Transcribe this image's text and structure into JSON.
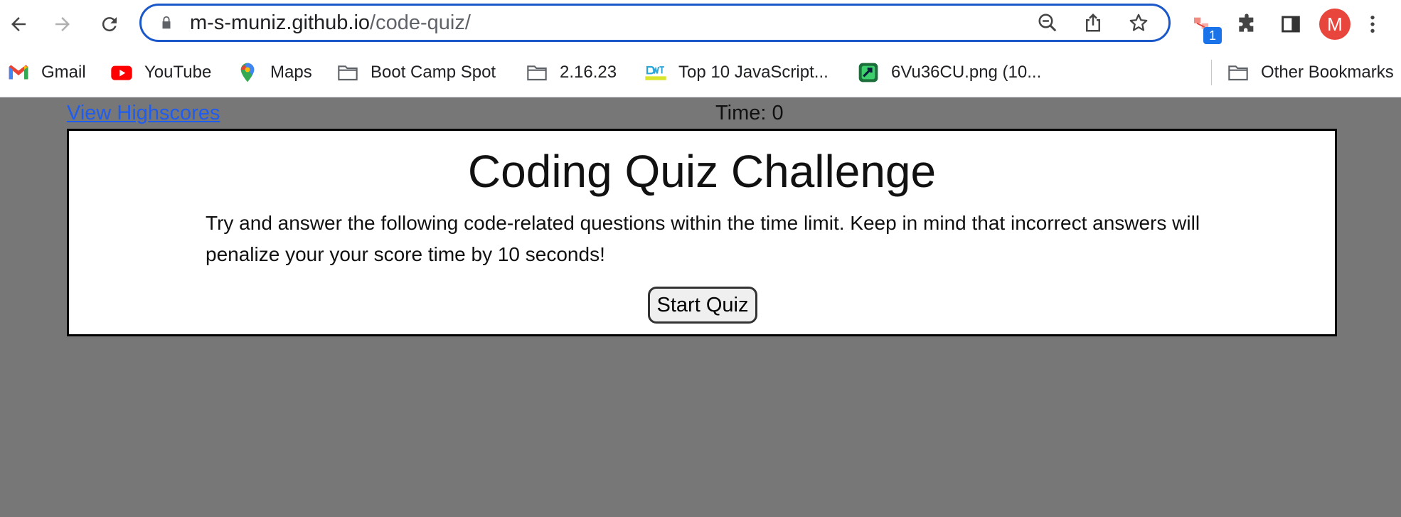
{
  "browser": {
    "url_host": "m-s-muniz.github.io",
    "url_path": "/code-quiz/",
    "extension_badge": "1",
    "profile_initial": "M",
    "icons": [
      "back-arrow-icon",
      "forward-arrow-icon",
      "reload-icon",
      "lock-icon",
      "zoom-out-icon",
      "share-icon",
      "star-icon",
      "extension-icon",
      "puzzle-icon",
      "side-panel-icon",
      "more-vert-icon"
    ]
  },
  "bookmarks": {
    "items": [
      {
        "label": "Gmail",
        "icon": "gmail-icon"
      },
      {
        "label": "YouTube",
        "icon": "youtube-icon"
      },
      {
        "label": "Maps",
        "icon": "maps-icon"
      },
      {
        "label": "Boot Camp Spot",
        "icon": "folder-icon"
      },
      {
        "label": "2.16.23",
        "icon": "folder-icon"
      },
      {
        "label": "Top 10 JavaScript...",
        "icon": "dwt-icon"
      },
      {
        "label": "6Vu36CU.png (10...",
        "icon": "image-icon"
      }
    ],
    "other": "Other Bookmarks"
  },
  "page": {
    "highscores_link": "View Highscores",
    "timer": "Time: 0",
    "title": "Coding Quiz Challenge",
    "description": "Try and answer the following code-related questions within the time limit. Keep in mind that incorrect answers will penalize your your score time by 10 seconds!",
    "start_button": "Start Quiz"
  },
  "colors": {
    "page_background": "#777777",
    "link": "#1f5cf0",
    "omnibox_border": "#1a57c9",
    "avatar": "#e8453c"
  }
}
